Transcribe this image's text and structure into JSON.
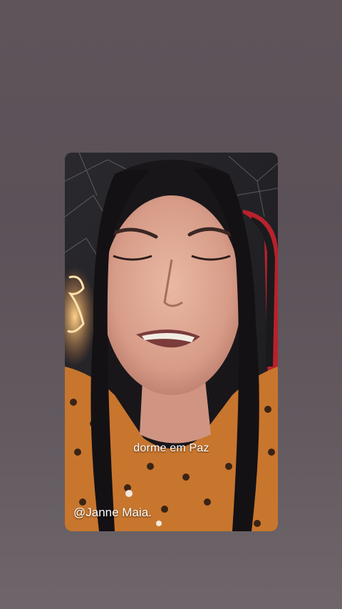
{
  "story": {
    "caption": "dorme em Paz",
    "handle": "@Janne Maia."
  },
  "colors": {
    "background": "#5e545a",
    "text": "#ffffff"
  }
}
